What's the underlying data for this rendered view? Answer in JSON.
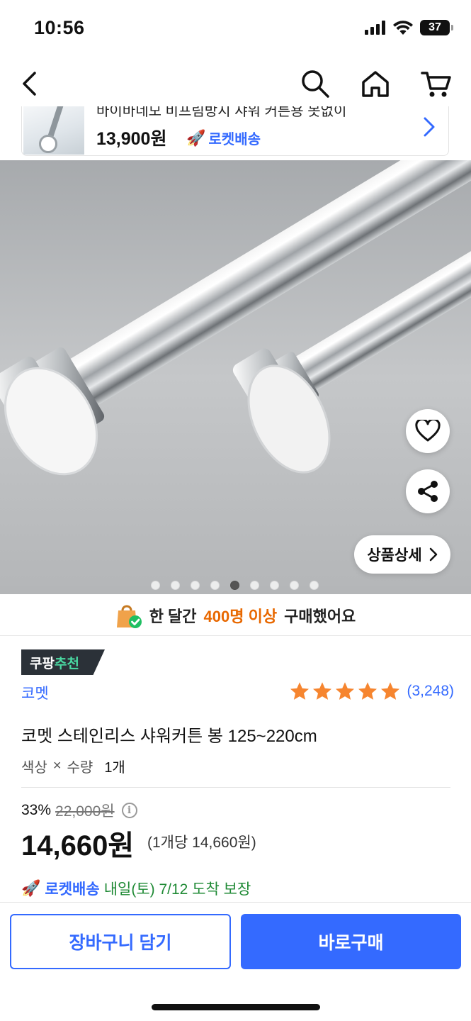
{
  "status_bar": {
    "time": "10:56",
    "battery": "37"
  },
  "nav": {
    "back_icon": "back-arrow-icon",
    "search_icon": "search-icon",
    "home_icon": "home-icon",
    "cart_icon": "cart-icon"
  },
  "recent_product": {
    "title": "바이바네모 비프림방지 샤워 커튼용 못없이",
    "price": "13,900원",
    "delivery_badge": "로켓배송"
  },
  "gallery": {
    "detail_label": "상품상세",
    "dot_count": 9,
    "active_dot": 5
  },
  "purchase_banner": {
    "prefix": "한 달간",
    "highlight": "400명 이상",
    "suffix": "구매했어요"
  },
  "badge": {
    "part1": "쿠팡",
    "part2": "추천"
  },
  "brand": "코멧",
  "rating": {
    "stars": 5,
    "count": "(3,248)"
  },
  "product_name": "코멧 스테인리스 샤워커튼 봉 125~220cm",
  "option": {
    "label_color": "색상",
    "sep": "×",
    "label_qty": "수량",
    "qty": "1개"
  },
  "price": {
    "discount": "33%",
    "original": "22,000원",
    "sale": "14,660원",
    "unit": "(1개당 14,660원)"
  },
  "delivery": {
    "label": "로켓배송",
    "arrival": "내일(토) 7/12 도착 보장"
  },
  "buttons": {
    "cart": "장바구니 담기",
    "buy": "바로구매"
  },
  "colors": {
    "accent": "#346aff",
    "orange": "#e86800",
    "star": "#f6852f",
    "green": "#1f8a35"
  }
}
